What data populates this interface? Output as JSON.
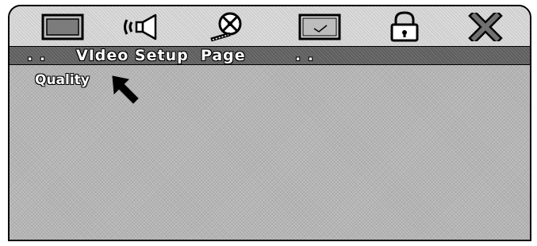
{
  "toolbar": {
    "icons": [
      "monitor-icon",
      "speaker-icon",
      "film-reel-icon",
      "screen-icon",
      "padlock-icon",
      "close-icon"
    ]
  },
  "header": {
    "dots_left": ". .",
    "title": "VIdeo Setup  Page",
    "dots_right": ". ."
  },
  "menu": {
    "items": [
      {
        "label": "Quality"
      }
    ]
  },
  "cursor": {
    "icon": "arrow-cursor-icon"
  },
  "colors": {
    "screen_bg": "#b4b4b4",
    "toolbar_bg": "#cfcfcf",
    "titlebar_bg": "#5e5e5e",
    "text": "#ffffff",
    "outline": "#000000"
  }
}
